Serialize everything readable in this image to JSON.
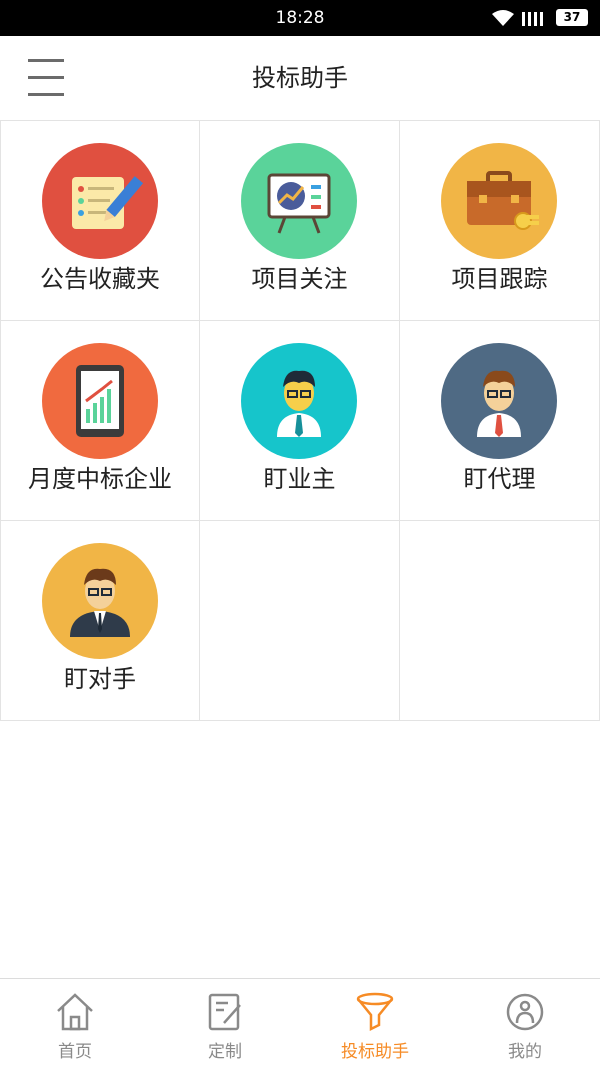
{
  "status_bar": {
    "time": "18:28",
    "battery": "37"
  },
  "header": {
    "title": "投标助手"
  },
  "grid": {
    "items": [
      {
        "label": "公告收藏夹",
        "color": "#e05040",
        "icon": "notepad-icon"
      },
      {
        "label": "项目关注",
        "color": "#5ad39a",
        "icon": "presentation-board-icon"
      },
      {
        "label": "项目跟踪",
        "color": "#f1b546",
        "icon": "briefcase-icon"
      },
      {
        "label": "月度中标企业",
        "color": "#f06a3f",
        "icon": "tablet-chart-icon"
      },
      {
        "label": "盯业主",
        "color": "#16c5cb",
        "icon": "owner-avatar-icon"
      },
      {
        "label": "盯代理",
        "color": "#4f6a84",
        "icon": "agent-avatar-icon"
      },
      {
        "label": "盯对手",
        "color": "#f1b546",
        "icon": "competitor-avatar-icon"
      }
    ]
  },
  "tabbar": {
    "items": [
      {
        "label": "首页",
        "icon": "home-icon",
        "active": false
      },
      {
        "label": "定制",
        "icon": "edit-note-icon",
        "active": false
      },
      {
        "label": "投标助手",
        "icon": "funnel-icon",
        "active": true
      },
      {
        "label": "我的",
        "icon": "profile-icon",
        "active": false
      }
    ],
    "active_color": "#f68b25",
    "inactive_color": "#8a8a8a"
  }
}
